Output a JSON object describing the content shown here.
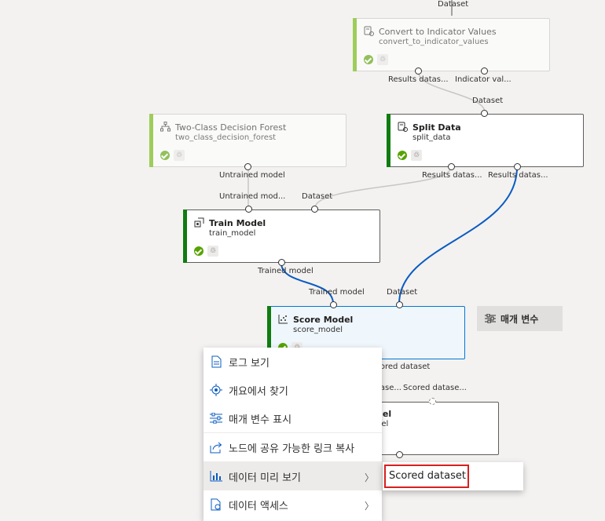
{
  "colors": {
    "success": "#57a300",
    "selected_border": "#0078d4",
    "accent_edge": "#0b5cc2",
    "highlight_box": "#d6201f"
  },
  "edges_labels": {
    "top_dataset": "Dataset",
    "civ_out1": "Results datas...",
    "civ_out2": "Indicator val...",
    "split_in": "Dataset",
    "split_out1": "Results datas...",
    "split_out2": "Results datas...",
    "forest_out": "Untrained model",
    "train_in1": "Untrained mod...",
    "train_in2": "Dataset",
    "train_out": "Trained model",
    "score_in1": "Trained model",
    "score_in2": "Dataset",
    "score_out": "Scored dataset",
    "eval_in1": "Scored datase...",
    "eval_in2": "Scored datase..."
  },
  "nodes": {
    "convert": {
      "title": "Convert to Indicator Values",
      "name": "convert_to_indicator_values",
      "icon": "dataset-transform-icon"
    },
    "forest": {
      "title": "Two-Class Decision Forest",
      "name": "two_class_decision_forest",
      "icon": "tree-icon"
    },
    "split": {
      "title": "Split Data",
      "name": "split_data",
      "icon": "dataset-transform-icon"
    },
    "train": {
      "title": "Train Model",
      "name": "train_model",
      "icon": "train-icon"
    },
    "score": {
      "title": "Score Model",
      "name": "score_model",
      "icon": "scatter-icon"
    },
    "evaluate": {
      "title": "del",
      "name": "del"
    }
  },
  "param_button": {
    "label": "매개 변수",
    "icon": "sliders-icon"
  },
  "context_menu": {
    "items": [
      {
        "label": "로그 보기",
        "icon": "document-icon"
      },
      {
        "label": "개요에서 찾기",
        "icon": "locate-icon"
      },
      {
        "label": "매개 변수 표시",
        "icon": "sliders-icon"
      },
      {
        "label": "노드에 공유 가능한 링크 복사",
        "icon": "share-icon"
      },
      {
        "label": "데이터 미리 보기",
        "icon": "chart-icon"
      },
      {
        "label": "데이터 액세스",
        "icon": "file-access-icon"
      }
    ]
  },
  "submenu": {
    "item": "Scored dataset"
  },
  "reuse_symbol": "♲"
}
